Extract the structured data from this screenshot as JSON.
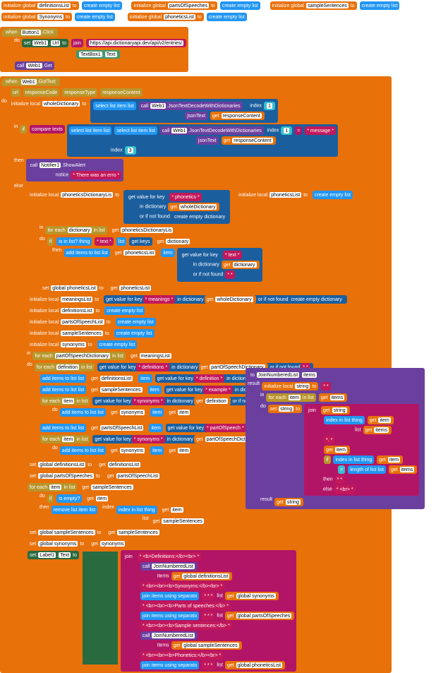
{
  "globals": {
    "init_prefix": "initialize global",
    "vars": [
      "definitionsList",
      "partsOfSpeeches",
      "sampleSentences",
      "Synonyms",
      "phoneticsList"
    ],
    "to": "to",
    "create_empty_list": "create empty list"
  },
  "button_click": {
    "when": "when",
    "component": "Button1",
    "event": "Click",
    "do": "do",
    "set": "set",
    "web_url": "Web1",
    "url_prop": "Url",
    "to": "to",
    "join": "join",
    "url": "https://api.dictionaryapi.dev/api/v2/entries/",
    "textbox": "TextBox1",
    "text": "Text",
    "call": "call",
    "get": "Get"
  },
  "got_text": {
    "when": "when",
    "component": "Web1",
    "event": "GotText",
    "params": [
      "url",
      "responseCode",
      "responseType",
      "responseContent"
    ],
    "do": "do",
    "init_local": "initialize local",
    "wholeDictionary": "wholeDictionary",
    "to": "to",
    "select_list_item": "select list item",
    "list": "list",
    "call": "call",
    "json_decode": "JsonTextDecodeWithDictionaries",
    "jsonText": "jsonText",
    "get": "get",
    "responseContent": "responseContent",
    "index": "index",
    "one": "1",
    "in": "in",
    "if": "if",
    "compare_texts": "compare texts",
    "three": "3",
    "message": "* message *",
    "then": "then",
    "notifier": "Notifier1",
    "show_alert": "ShowAlert",
    "notice": "notice",
    "error_text": "* There was an erro *",
    "else": "else"
  },
  "phonetics": {
    "init_local": "initialize local",
    "phoneticsDictionaryList": "phoneticsDictionaryLis",
    "to": "to",
    "get_value": "get value for key",
    "phonetics_key": "* phonetics *",
    "in_dict": "in dictionary",
    "get": "get",
    "wholeDictionary": "wholeDictionary",
    "not_found": "or if not found",
    "create_empty_dict": "create empty dictionary",
    "phoneticsList": "phoneticsList",
    "create_empty_list": "create empty list",
    "in": "in",
    "for_each": "for each",
    "dictionary": "dictionary",
    "in_list": "in list",
    "do": "do",
    "if": "if",
    "is_in_list": "is in list? thing",
    "text_key": "* text *",
    "list": "list",
    "get_keys": "get keys",
    "then": "then",
    "add_items": "add items to list",
    "item": "item",
    "star": "* *",
    "set": "set",
    "global_phoneticsList": "global phoneticsList"
  },
  "meanings": {
    "init_local": "initialize local",
    "meaningsList": "meaningsList",
    "to": "to",
    "get_value": "get value for key",
    "meanings_key": "* meanings *",
    "in_dict": "in dictionary",
    "get": "get",
    "wholeDictionary": "wholeDictionary",
    "not_found": "or if not found",
    "create_empty_dict": "create empty dictionary",
    "definitionsList": "definitionsList",
    "partsOfSpeechList": "partsOfSpeechList",
    "sampleSentences": "sampleSentences",
    "synonyms": "synonyms",
    "create_empty_list": "create empty list",
    "in": "in",
    "for_each": "for each",
    "partOfSpeechDictionary": "partOfSpeechDictionary",
    "in_list": "in list",
    "do": "do",
    "definition": "definition",
    "definitions_key": "* definitions *",
    "star": "* *",
    "add_items": "add items to list",
    "list": "list",
    "item": "item",
    "definition_key": "* definition *",
    "example_key": "* example *",
    "space": "*   *",
    "synonyms_key": "* synonyms *",
    "partOfSpeech_key": "* partOfSpeech *",
    "partsOfSpeechList2": "partsOfSpeechList",
    "set": "set",
    "global_definitionsList": "global definitionsList",
    "global_partsOfSpeeches": "global partsOfSpeeches",
    "global_sampleSentences": "global sampleSentences",
    "global_synonyms": "global synonyms",
    "is_empty": "is empty?",
    "if": "if",
    "then": "then",
    "remove_item": "remove list item",
    "index": "index",
    "index_in_list": "index in list",
    "thing": "thing"
  },
  "output": {
    "set": "set",
    "label": "Label1",
    "text": "Text",
    "to": "to",
    "join": "join",
    "definitions_header": "* <b>Definitions:</b><br> *",
    "call": "call",
    "join_numbered": "JoinNumberedList",
    "items": "items",
    "get": "get",
    "global_definitionsList": "global definitionsList",
    "synonyms_header": "* <br><br><b>Synonyms:</b><br> *",
    "join_items": "join items using separato",
    "separator": "*  *  *",
    "list": "list",
    "global_synonyms": "global synonyms",
    "pos_header": "* <br><br><b>Parts of speeches:</b> *",
    "global_partsOfSpeeches": "global partsOfSpeeches",
    "sample_header": "* <br><br><b>Sample sentences:</b> *",
    "global_sampleSentences": "global sampleSentences",
    "phonetics_header": "* <br><br><b>Phonetics:</b><br> *",
    "global_phoneticsList": "global phoneticsList"
  },
  "procedure": {
    "to": "to",
    "name": "JoinNumberedList",
    "items": "items",
    "result": "result",
    "init_local": "initialize local",
    "string": "string",
    "empty": "*  *",
    "in": "in",
    "for_each": "for each",
    "item": "item",
    "in_list": "in list",
    "get": "get",
    "do": "do",
    "set": "set",
    "join": "join",
    "index_in_list": "index in list",
    "thing": "thing",
    "list": "list",
    "dot": "*.  *",
    "newline": "* <br> *",
    "length": "length of list",
    "if": "if",
    "then": "then",
    "else": "else",
    "eq": "="
  }
}
